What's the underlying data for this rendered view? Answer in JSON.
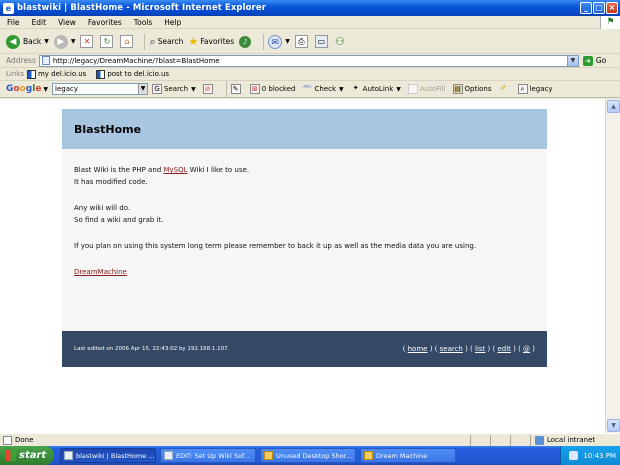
{
  "window": {
    "title": "blastwiki | BlastHome - Microsoft Internet Explorer"
  },
  "menu": [
    "File",
    "Edit",
    "View",
    "Favorites",
    "Tools",
    "Help"
  ],
  "toolbar": {
    "back": "Back",
    "search": "Search",
    "favorites": "Favorites"
  },
  "address": {
    "label": "Address",
    "url": "http://legacy/DreamMachine/?blast=BlastHome",
    "go": "Go"
  },
  "links": {
    "label": "Links",
    "items": [
      "my del.icio.us",
      "post to del.icio.us"
    ]
  },
  "google": {
    "logo": "Google",
    "query": "legacy",
    "search": "Search",
    "blocked": "0 blocked",
    "check": "Check",
    "autolink": "AutoLink",
    "autofill": "AutoFill",
    "options": "Options",
    "highlight": "legacy"
  },
  "page": {
    "title": "BlastHome",
    "line1_pre": "Blast Wiki is the PHP and ",
    "line1_link": "MySQL",
    "line1_post": " Wiki I like to use.",
    "line2": "It has modified code.",
    "line3": "Any wiki will do.",
    "line4": "So find a wiki and grab it.",
    "line5": "If you plan on using this system long term please remember to back it up as well as the media data you are using.",
    "link": "DreamMachine",
    "footer_edited": "Last edited on 2006 Apr 15, 22:43:02 by 192.168.1.107.",
    "nav": [
      "home",
      "search",
      "list",
      "edit",
      "@"
    ]
  },
  "status": {
    "text": "Done",
    "zone": "Local intranet"
  },
  "taskbar": {
    "start": "start",
    "tasks": [
      "blastwiki | BlastHome ...",
      "EDIT: Set Up Wiki Sof...",
      "Unused Desktop Shor...",
      "Dream Machine"
    ],
    "clock": "10:43 PM"
  }
}
